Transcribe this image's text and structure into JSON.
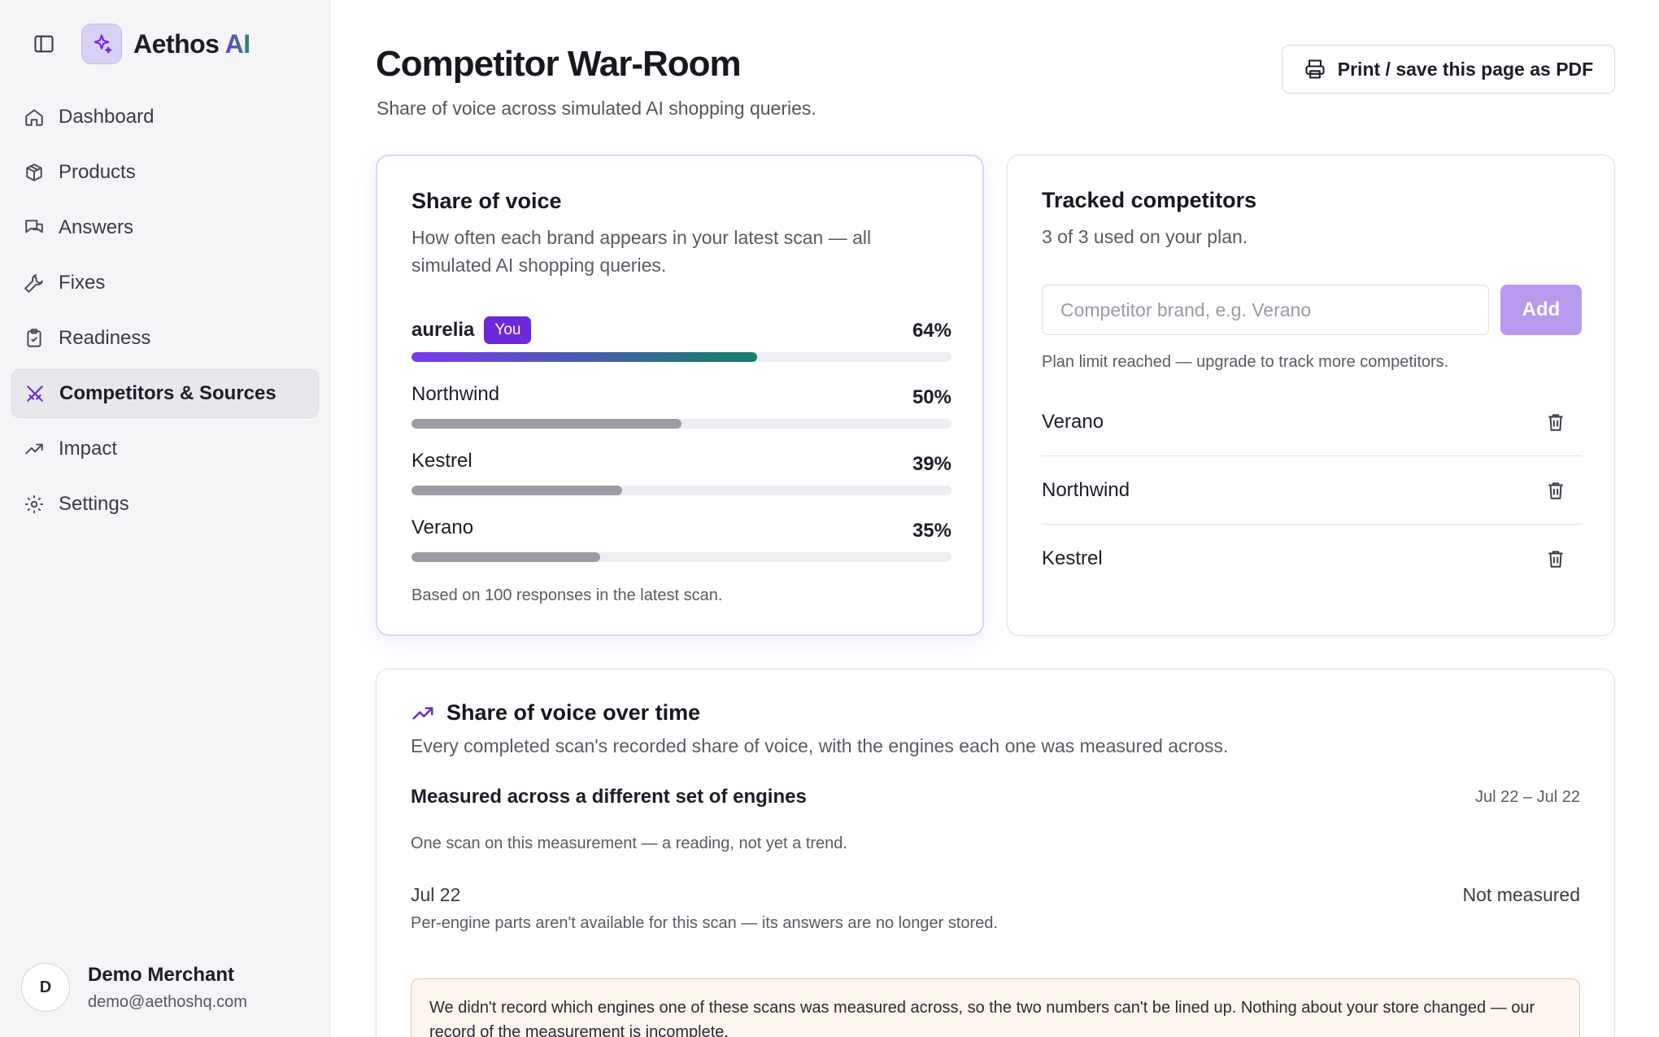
{
  "brand": {
    "name": "Aethos",
    "suffix": "AI"
  },
  "nav": {
    "items": [
      {
        "label": "Dashboard",
        "icon": "home-icon"
      },
      {
        "label": "Products",
        "icon": "package-icon"
      },
      {
        "label": "Answers",
        "icon": "messages-icon"
      },
      {
        "label": "Fixes",
        "icon": "wrench-icon"
      },
      {
        "label": "Readiness",
        "icon": "clipboard-check-icon"
      },
      {
        "label": "Competitors & Sources",
        "icon": "swords-icon",
        "active": true
      },
      {
        "label": "Impact",
        "icon": "trending-up-icon"
      },
      {
        "label": "Settings",
        "icon": "gear-icon"
      }
    ]
  },
  "user": {
    "initial": "D",
    "name": "Demo Merchant",
    "email": "demo@aethoshq.com"
  },
  "page": {
    "title": "Competitor War-Room",
    "subtitle": "Share of voice across simulated AI shopping queries.",
    "print_label": "Print / save this page as PDF"
  },
  "share_of_voice": {
    "title": "Share of voice",
    "description": "How often each brand appears in your latest scan — all simulated AI shopping queries.",
    "you_badge": "You",
    "footer": "Based on 100 responses in the latest scan.",
    "brands": [
      {
        "name": "aurelia",
        "pct_label": "64%",
        "value": 0.64,
        "is_you": true
      },
      {
        "name": "Northwind",
        "pct_label": "50%",
        "value": 0.5
      },
      {
        "name": "Kestrel",
        "pct_label": "39%",
        "value": 0.39
      },
      {
        "name": "Verano",
        "pct_label": "35%",
        "value": 0.35
      }
    ],
    "accent_start": "#7c3aed",
    "accent_end": "#15806a"
  },
  "tracked": {
    "title": "Tracked competitors",
    "usage": "3 of 3 used on your plan.",
    "input_placeholder": "Competitor brand, e.g. Verano",
    "add_label": "Add",
    "limit_note": "Plan limit reached — upgrade to track more competitors.",
    "competitors": [
      "Verano",
      "Northwind",
      "Kestrel"
    ]
  },
  "over_time": {
    "title": "Share of voice over time",
    "description": "Every completed scan's recorded share of voice, with the engines each one was measured across.",
    "measurement_title": "Measured across a different set of engines",
    "measurement_range": "Jul 22 – Jul 22",
    "measurement_note": "One scan on this measurement — a reading, not yet a trend.",
    "scan_date": "Jul 22",
    "scan_status": "Not measured",
    "scan_note": "Per-engine parts aren't available for this scan — its answers are no longer stored.",
    "warning": "We didn't record which engines one of these scans was measured across, so the two numbers can't be lined up. Nothing about your store changed — our record of the measurement is incomplete."
  }
}
